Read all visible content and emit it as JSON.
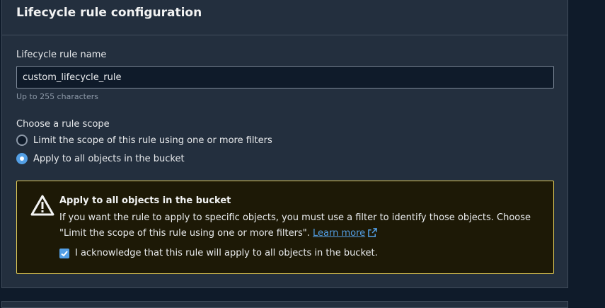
{
  "panel": {
    "title": "Lifecycle rule configuration"
  },
  "rule_name": {
    "label": "Lifecycle rule name",
    "value": "custom_lifecycle_rule",
    "hint": "Up to 255 characters"
  },
  "scope": {
    "label": "Choose a rule scope",
    "options": [
      {
        "label": "Limit the scope of this rule using one or more filters",
        "checked": false
      },
      {
        "label": "Apply to all objects in the bucket",
        "checked": true
      }
    ]
  },
  "warning": {
    "title": "Apply to all objects in the bucket",
    "text_line1": "If you want the rule to apply to specific objects, you must use a filter to identify those objects. Choose",
    "text_line2": "\"Limit the scope of this rule using one or more filters\".",
    "link": "Learn more",
    "ack_label": "I acknowledge that this rule will apply to all objects in the bucket.",
    "ack_checked": true
  },
  "icons": {
    "warning": "warning-triangle-icon",
    "external": "external-link-icon",
    "check": "checkmark-icon"
  },
  "colors": {
    "accent": "#539fe5",
    "warning_border": "#e0ca57",
    "panel_bg": "#232f3e"
  }
}
